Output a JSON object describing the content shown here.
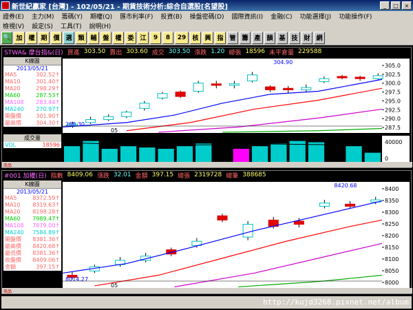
{
  "window": {
    "title": "新世紀贏家 [台灣] - 102/05/21 - 期貨技術分析:綜合自選股[名望股]"
  },
  "menu": {
    "row1": [
      "證券(E)",
      "主力(M)",
      "籌碼(Y)",
      "期權(Q)",
      "匯市利率(F)",
      "投資(B)",
      "操盤密碼(D)",
      "國際資訊(I)",
      "金融(C)",
      "功能選擇(J)",
      "功能操作(F)"
    ],
    "row2": [
      "檢視(V)",
      "設定(S)",
      "工具(T)",
      "說明(H)"
    ]
  },
  "toolbar": [
    "加",
    "權",
    "期",
    "價",
    "選",
    "類",
    "輔",
    "盤",
    "權",
    "委",
    "江",
    "9",
    "8",
    "29",
    "核",
    "興",
    "指",
    "管",
    "籌",
    "產",
    "韻",
    "基",
    "技",
    "財",
    "網"
  ],
  "panel1": {
    "symbol": "STWA& 摩台指&(日)",
    "bid_label": "買進",
    "bid": "303.50",
    "ask_label": "賣出",
    "ask": "303.60",
    "last_label": "成交",
    "last": "303.50",
    "chg_label": "漲跌",
    "chg": "1.20",
    "vol_label": "總張",
    "vol": "18596",
    "oi_label": "未平倉量",
    "oi": "229588",
    "legend_title": "K線圖",
    "legend_date": "2013/05/21",
    "legend": [
      {
        "k": "MA5",
        "v": "302.52",
        "c": "#ff6666"
      },
      {
        "k": "MA10",
        "v": "301.40",
        "c": "#ff6666"
      },
      {
        "k": "MA20",
        "v": "298.29",
        "c": "#ff6666"
      },
      {
        "k": "MA60",
        "v": "287.53",
        "c": "#00cc00"
      },
      {
        "k": "MA108",
        "v": "283.44",
        "c": "#ff66ff"
      },
      {
        "k": "MA240",
        "v": "270.97",
        "c": "#00cccc"
      },
      {
        "k": "開盤價",
        "v": "301.90",
        "c": "#ff6666"
      },
      {
        "k": "最高價",
        "v": "304.30",
        "c": "#ff6666"
      }
    ],
    "y_ticks": [
      "305.0",
      "302.5",
      "300.0",
      "297.5",
      "295.0",
      "292.5",
      "290.0",
      "287.5"
    ],
    "low_label": "288.30",
    "high_label": "304.90",
    "x_label": "05",
    "vol_title": "成交量",
    "vol_key": "VOL",
    "vol_val": "18596",
    "vol_tick": "40000",
    "vol_tick2": "0",
    "foot": "商品"
  },
  "panel2": {
    "symbol": "#001 加權(日)",
    "idx_label": "指數",
    "idx": "8409.06",
    "chg_label": "漲跌",
    "chg": "32.01",
    "amt_label": "金額",
    "amt": "397.15",
    "vol_label": "總張",
    "vol": "2319728",
    "cnt_label": "總筆",
    "cnt": "388685",
    "legend_title": "K線圖",
    "legend_date": "2013/05/21",
    "legend": [
      {
        "k": "MA5",
        "v": "8372.59",
        "c": "#ff6666"
      },
      {
        "k": "MA10",
        "v": "8319.63",
        "c": "#ff6666"
      },
      {
        "k": "MA20",
        "v": "8198.28",
        "c": "#ff6666"
      },
      {
        "k": "MA60",
        "v": "7989.47",
        "c": "#00cc00"
      },
      {
        "k": "MA108",
        "v": "7879.00",
        "c": "#ff66ff"
      },
      {
        "k": "MA240",
        "v": "7584.89",
        "c": "#00cccc"
      },
      {
        "k": "開盤價",
        "v": "8381.36",
        "c": "#ff6666"
      },
      {
        "k": "最高價",
        "v": "8420.68",
        "c": "#ff6666"
      },
      {
        "k": "最低價",
        "v": "8381.36",
        "c": "#ff6666"
      },
      {
        "k": "收盤價",
        "v": "8409.06",
        "c": "#ff6666"
      },
      {
        "k": "金額",
        "v": "397.15",
        "c": "#ff6666"
      }
    ],
    "y_ticks": [
      "8400",
      "8350",
      "8300",
      "8250",
      "8200",
      "8150",
      "8100",
      "8050",
      "8000"
    ],
    "low_label": "8014.27",
    "high_label": "8420.68",
    "x_label": "05",
    "foot": "商品"
  },
  "watermark": "http://kujd3268.pixnet.net/album"
}
